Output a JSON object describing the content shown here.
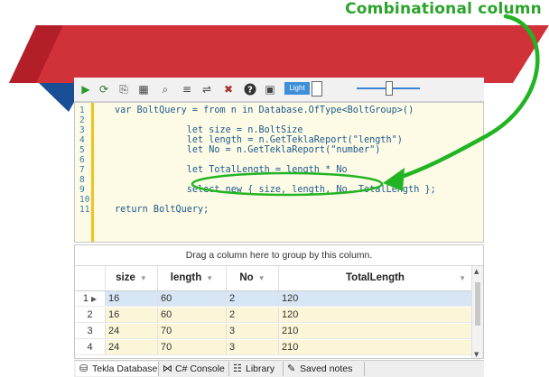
{
  "annotation": {
    "title": "Combinational column",
    "accent_color": "#2aa42a"
  },
  "toolbar": {
    "run_icon": "play-icon",
    "light_label": "Light",
    "icons": [
      "play-icon",
      "refresh-icon",
      "clipboard-icon",
      "table-icon",
      "find-icon",
      "list-icon",
      "format-icon",
      "clear-icon",
      "help-icon",
      "screen-icon"
    ]
  },
  "editor": {
    "line_numbers": [
      "1",
      "2",
      "3",
      "4",
      "5",
      "6",
      "7",
      "8",
      "9",
      "10",
      "11"
    ],
    "lines": [
      "var BoltQuery = from n in Database.OfType<BoltGroup>()",
      "",
      "             let size = n.BoltSize",
      "             let length = n.GetTeklaReport(\"length\")",
      "             let No = n.GetTeklaReport(\"number\")",
      "",
      "             let TotalLength = length * No",
      "",
      "             select new { size, length, No, TotalLength };",
      "",
      "return BoltQuery;"
    ]
  },
  "grid": {
    "group_hint": "Drag a column here to group by this column.",
    "columns": [
      "size",
      "length",
      "No",
      "TotalLength"
    ],
    "rows": [
      {
        "num": "1",
        "size": "16",
        "length": "60",
        "no": "2",
        "total": "120"
      },
      {
        "num": "2",
        "size": "16",
        "length": "60",
        "no": "2",
        "total": "120"
      },
      {
        "num": "3",
        "size": "24",
        "length": "70",
        "no": "3",
        "total": "210"
      },
      {
        "num": "4",
        "size": "24",
        "length": "70",
        "no": "3",
        "total": "210"
      }
    ]
  },
  "tabs": [
    {
      "label": "Tekla Database",
      "icon": "database-icon"
    },
    {
      "label": "C# Console",
      "icon": "console-icon"
    },
    {
      "label": "Library",
      "icon": "library-icon"
    },
    {
      "label": "Saved notes",
      "icon": "notes-icon"
    }
  ]
}
